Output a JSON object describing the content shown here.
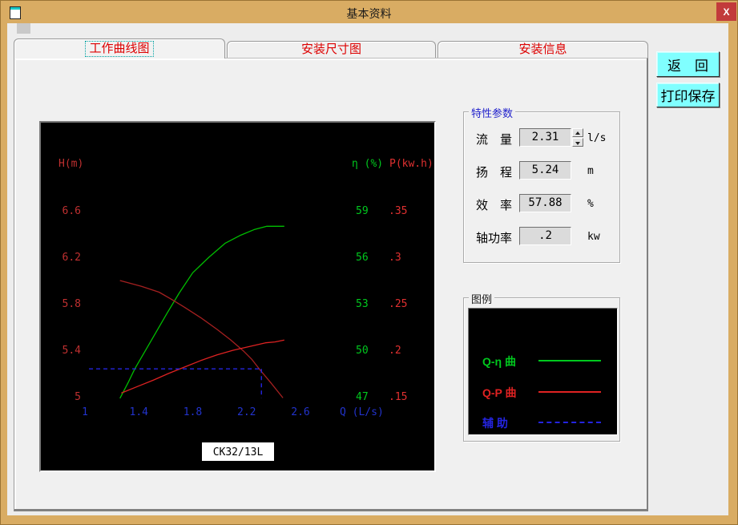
{
  "window": {
    "title": "基本资料",
    "close_glyph": "X"
  },
  "tabs": [
    {
      "label": "工作曲线图",
      "selected": true
    },
    {
      "label": "安装尺寸图",
      "selected": false
    },
    {
      "label": "安装信息",
      "selected": false
    }
  ],
  "actions": {
    "back": "返　回",
    "print_save": "打印保存"
  },
  "params": {
    "title": "特性参数",
    "rows": [
      {
        "label": "流　量",
        "value": "2.31",
        "unit": "l/s"
      },
      {
        "label": "扬　程",
        "value": "5.24",
        "unit": "m"
      },
      {
        "label": "效　率",
        "value": "57.88",
        "unit": "%"
      },
      {
        "label": "轴功率",
        "value": ".2",
        "unit": "kw"
      }
    ]
  },
  "legend": {
    "title": "图例",
    "items": [
      {
        "label": "Q-η 曲",
        "color": "#00C81E",
        "style": "solid"
      },
      {
        "label": "Q-P 曲",
        "color": "#E02222",
        "style": "solid"
      },
      {
        "label": "辅 助",
        "color": "#2424E0",
        "style": "dashed"
      }
    ]
  },
  "chart_data": {
    "type": "line",
    "model_label": "CK32/13L",
    "background": "#000000",
    "axes": {
      "x": {
        "label": "Q (L/s)",
        "color": "#2233CC",
        "ticks": [
          "1",
          "1.4",
          "1.8",
          "2.2",
          "2.6"
        ],
        "min": 1,
        "max": 2.6
      },
      "h": {
        "label": "H(m)",
        "color": "#C03030",
        "ticks": [
          "6.6",
          "6.2",
          "5.8",
          "5.4",
          "5"
        ]
      },
      "eta": {
        "label": "η (%)",
        "color": "#00C81E",
        "ticks": [
          "59",
          "56",
          "53",
          "50",
          "47"
        ]
      },
      "p": {
        "label": "P(kw.h)",
        "color": "#E03030",
        "ticks": [
          ".35",
          ".3",
          ".25",
          ".2",
          ".15"
        ]
      }
    },
    "series": [
      {
        "name": "Q-η",
        "axis": "eta",
        "color": "#00BE00",
        "points": [
          [
            1.26,
            46.9
          ],
          [
            1.32,
            47.9
          ],
          [
            1.37,
            48.8
          ],
          [
            1.49,
            50.6
          ],
          [
            1.61,
            52.4
          ],
          [
            1.7,
            53.7
          ],
          [
            1.8,
            55.0
          ],
          [
            1.92,
            56.0
          ],
          [
            2.04,
            56.9
          ],
          [
            2.15,
            57.4
          ],
          [
            2.26,
            57.8
          ],
          [
            2.35,
            58.0
          ],
          [
            2.44,
            58.0
          ],
          [
            2.48,
            58.0
          ]
        ]
      },
      {
        "name": "Q-H",
        "axis": "h",
        "color": "#A52020",
        "points": [
          [
            1.26,
            6.0
          ],
          [
            1.42,
            5.95
          ],
          [
            1.55,
            5.9
          ],
          [
            1.64,
            5.84
          ],
          [
            1.74,
            5.77
          ],
          [
            1.86,
            5.68
          ],
          [
            1.98,
            5.58
          ],
          [
            2.08,
            5.49
          ],
          [
            2.18,
            5.39
          ],
          [
            2.24,
            5.32
          ],
          [
            2.3,
            5.23
          ],
          [
            2.38,
            5.12
          ],
          [
            2.47,
            4.99
          ]
        ]
      },
      {
        "name": "Q-P",
        "axis": "p",
        "color": "#DD2222",
        "points": [
          [
            1.27,
            0.154
          ],
          [
            1.39,
            0.161
          ],
          [
            1.51,
            0.168
          ],
          [
            1.62,
            0.175
          ],
          [
            1.74,
            0.182
          ],
          [
            1.86,
            0.189
          ],
          [
            1.98,
            0.195
          ],
          [
            2.1,
            0.2
          ],
          [
            2.22,
            0.204
          ],
          [
            2.34,
            0.208
          ],
          [
            2.41,
            0.209
          ],
          [
            2.48,
            0.211
          ]
        ]
      }
    ],
    "auxiliary": {
      "color": "#2424E0",
      "q": 2.31,
      "h": 5.24,
      "q_line_start": 1.03,
      "h_line_end": 4.99
    }
  }
}
